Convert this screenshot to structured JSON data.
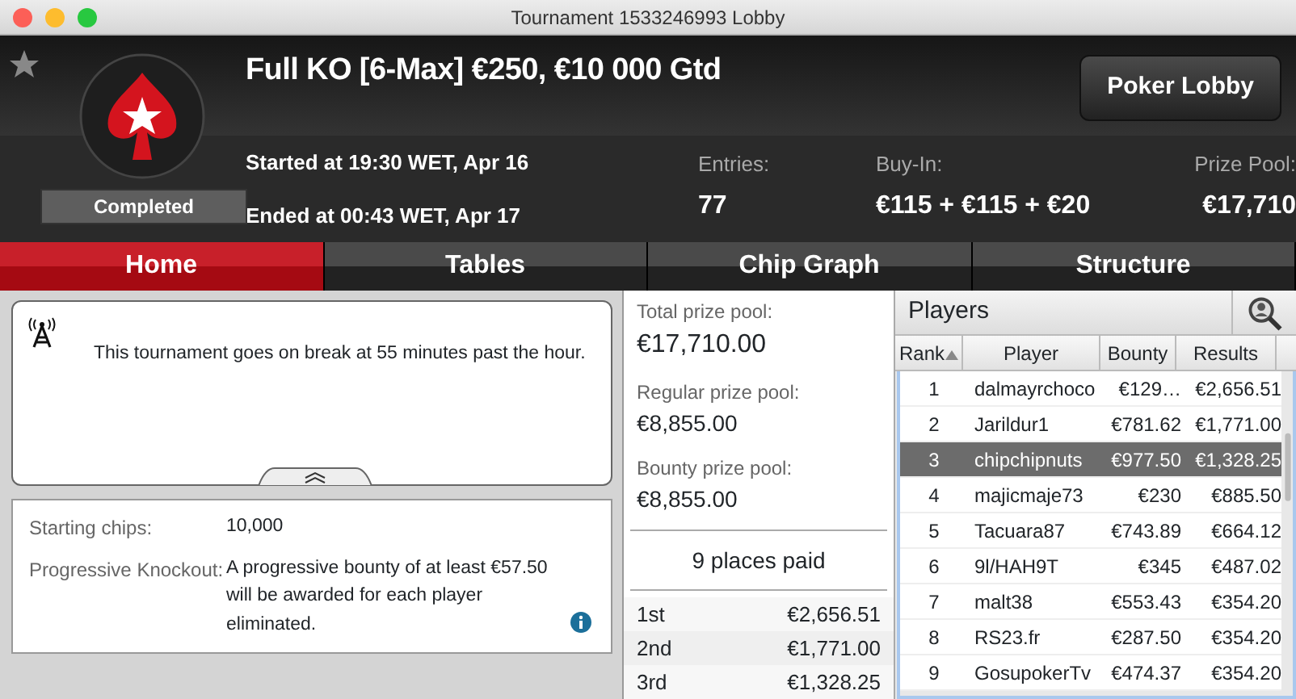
{
  "window": {
    "title": "Tournament 1533246993 Lobby"
  },
  "header": {
    "title": "Full KO [6-Max] €250, €10 000 Gtd",
    "status": "Completed",
    "started": "Started at 19:30 WET, Apr 16",
    "ended": "Ended at 00:43 WET, Apr 17",
    "lobby_button": "Poker Lobby",
    "stats": [
      {
        "label": "Entries:",
        "value": "77"
      },
      {
        "label": "Buy-In:",
        "value": "€115 + €115 + €20"
      },
      {
        "label": "Prize Pool:",
        "value": "€17,710"
      }
    ]
  },
  "tabs": [
    {
      "label": "Home",
      "selected": true
    },
    {
      "label": "Tables",
      "selected": false
    },
    {
      "label": "Chip Graph",
      "selected": false
    },
    {
      "label": "Structure",
      "selected": false
    }
  ],
  "notice": "This tournament goes on break at 55 minutes past the hour.",
  "details": [
    {
      "label": "Starting chips:",
      "value": "10,000"
    },
    {
      "label": "Progressive Knockout:",
      "value": "A progressive bounty of at least €57.50 will be awarded for each player eliminated."
    }
  ],
  "prize_pools": [
    {
      "label": "Total prize pool:",
      "value": "€17,710.00"
    },
    {
      "label": "Regular prize pool:",
      "value": "€8,855.00"
    },
    {
      "label": "Bounty prize pool:",
      "value": "€8,855.00"
    }
  ],
  "places_paid": "9 places paid",
  "payouts": [
    {
      "place": "1st",
      "amount": "€2,656.51"
    },
    {
      "place": "2nd",
      "amount": "€1,771.00"
    },
    {
      "place": "3rd",
      "amount": "€1,328.25"
    }
  ],
  "players": {
    "title": "Players",
    "columns": [
      "Rank",
      "Player",
      "Bounty",
      "Results"
    ],
    "rows": [
      {
        "rank": "1",
        "player": "dalmayrchoco",
        "bounty": "€129…",
        "results": "€2,656.51",
        "selected": false
      },
      {
        "rank": "2",
        "player": "Jarildur1",
        "bounty": "€781.62",
        "results": "€1,771.00",
        "selected": false
      },
      {
        "rank": "3",
        "player": "chipchipnuts",
        "bounty": "€977.50",
        "results": "€1,328.25",
        "selected": true
      },
      {
        "rank": "4",
        "player": "majicmaje73",
        "bounty": "€230",
        "results": "€885.50",
        "selected": false
      },
      {
        "rank": "5",
        "player": "Tacuara87",
        "bounty": "€743.89",
        "results": "€664.12",
        "selected": false
      },
      {
        "rank": "6",
        "player": "9l/HAH9T",
        "bounty": "€345",
        "results": "€487.02",
        "selected": false
      },
      {
        "rank": "7",
        "player": "malt38",
        "bounty": "€553.43",
        "results": "€354.20",
        "selected": false
      },
      {
        "rank": "8",
        "player": "RS23.fr",
        "bounty": "€287.50",
        "results": "€354.20",
        "selected": false
      },
      {
        "rank": "9",
        "player": "GosupokerTv",
        "bounty": "€474.37",
        "results": "€354.20",
        "selected": false
      }
    ]
  }
}
